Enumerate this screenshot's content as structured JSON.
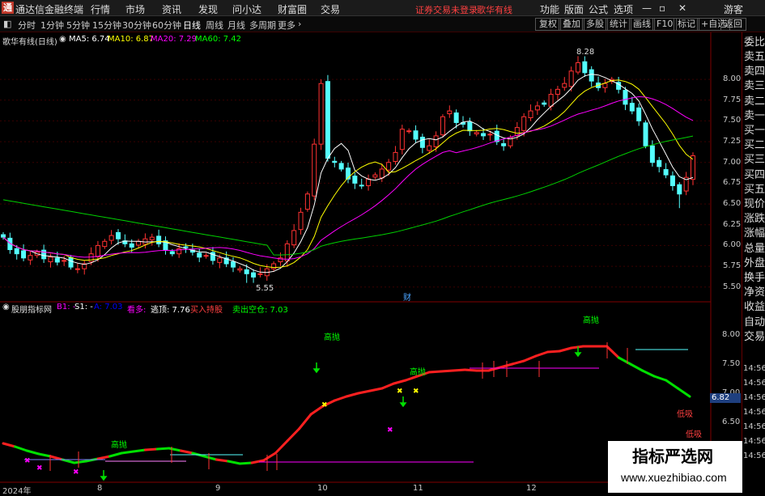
{
  "titlebar": {
    "app": "通达信金融终端",
    "menus": [
      "行情",
      "市场",
      "资讯",
      "发现",
      "问小达",
      "财富圈",
      "交易"
    ],
    "warning": "证券交易未登录",
    "warning2": "歌华有线",
    "right": [
      "功能",
      "版面",
      "公式",
      "选项"
    ],
    "guest": "游客"
  },
  "toolbar": {
    "periods": [
      "分时",
      "1分钟",
      "5分钟",
      "15分钟",
      "30分钟",
      "60分钟",
      "日线",
      "周线",
      "月线",
      "多周期",
      "更多"
    ],
    "active": "日线",
    "right": [
      "复权",
      "叠加",
      "多股",
      "统计",
      "画线",
      "F10",
      "标记",
      "+自选",
      "返回"
    ]
  },
  "main_chart": {
    "title": "歌华有线(日线)",
    "ma": [
      {
        "label": "MA5:",
        "value": "6.74",
        "color": "#ffffff"
      },
      {
        "label": "MA10:",
        "value": "6.87",
        "color": "#ffff00"
      },
      {
        "label": "MA20:",
        "value": "7.29",
        "color": "#ff00ff"
      },
      {
        "label": "MA60:",
        "value": "7.42",
        "color": "#00ff00"
      }
    ],
    "high_label": "8.28",
    "low_label": "5.55",
    "fin_label": "财",
    "price_ticks": [
      "8.00",
      "7.75",
      "7.50",
      "7.25",
      "7.00",
      "6.75",
      "6.50",
      "6.25",
      "6.00",
      "5.75",
      "5.50"
    ],
    "ylim": [
      5.4,
      8.4
    ]
  },
  "indicator": {
    "title": "股朋指标网",
    "items": [
      {
        "text": "B1: -",
        "color": "#ff00ff"
      },
      {
        "text": "S1: -",
        "color": "#ffffff"
      },
      {
        "text": "A: 7.03",
        "color": "#0000ff"
      },
      {
        "text": "看多:",
        "color": "#ff00ff"
      },
      {
        "text": "逃顶: 7.76",
        "color": "#ffffff"
      },
      {
        "text": "买入持股",
        "color": "#ff4040"
      },
      {
        "text": "卖出空仓: 7.03",
        "color": "#00ff00"
      }
    ],
    "ticks": [
      "8.00",
      "7.50",
      "7.00",
      "6.50"
    ],
    "current": "6.82",
    "high_sell": "高抛",
    "low_buy": "低吸"
  },
  "right_panel": {
    "top": "委比",
    "items": [
      "卖五",
      "卖四",
      "卖三",
      "卖二",
      "卖一",
      "买一",
      "买二",
      "买三",
      "买四",
      "买五",
      "现价",
      "涨跌",
      "涨幅",
      "总量",
      "外盘",
      "换手",
      "净资",
      "收益",
      "自动",
      "交易"
    ],
    "times": [
      "14:56",
      "14:56",
      "14:56",
      "14:56",
      "14:56",
      "14:56",
      "14:56"
    ]
  },
  "dates": [
    "2024年",
    "8",
    "9",
    "10",
    "11",
    "12"
  ],
  "watermark": {
    "cn": "指标严选网",
    "url": "www.xuezhibiao.com"
  },
  "chart_data": {
    "type": "candlestick",
    "ylim": [
      5.4,
      8.4
    ],
    "high": 8.28,
    "low": 5.55,
    "closes": [
      6.1,
      5.95,
      5.9,
      5.85,
      5.88,
      5.92,
      5.84,
      5.86,
      5.8,
      5.82,
      5.74,
      5.72,
      5.78,
      5.9,
      6.0,
      6.05,
      6.12,
      6.08,
      6.02,
      5.98,
      6.05,
      6.08,
      6.1,
      6.02,
      5.95,
      5.9,
      5.96,
      5.98,
      5.92,
      5.86,
      5.88,
      5.82,
      5.85,
      5.78,
      5.74,
      5.72,
      5.66,
      5.62,
      5.66,
      5.72,
      5.78,
      5.85,
      6.02,
      6.18,
      6.4,
      6.62,
      7.22,
      7.95,
      7.05,
      7.0,
      6.92,
      6.8,
      6.75,
      6.72,
      6.8,
      6.85,
      6.92,
      7.0,
      7.12,
      7.4,
      7.38,
      7.28,
      7.18,
      7.2,
      7.32,
      7.55,
      7.62,
      7.48,
      7.46,
      7.38,
      7.36,
      7.32,
      7.34,
      7.25,
      7.2,
      7.3,
      7.42,
      7.55,
      7.62,
      7.68,
      7.7,
      7.82,
      7.88,
      7.95,
      8.1,
      8.2,
      8.08,
      7.98,
      7.9,
      7.95,
      8.0,
      7.88,
      7.7,
      7.62,
      7.5,
      7.2,
      7.0,
      6.95,
      6.85,
      6.72,
      6.62,
      6.82,
      7.08
    ]
  }
}
